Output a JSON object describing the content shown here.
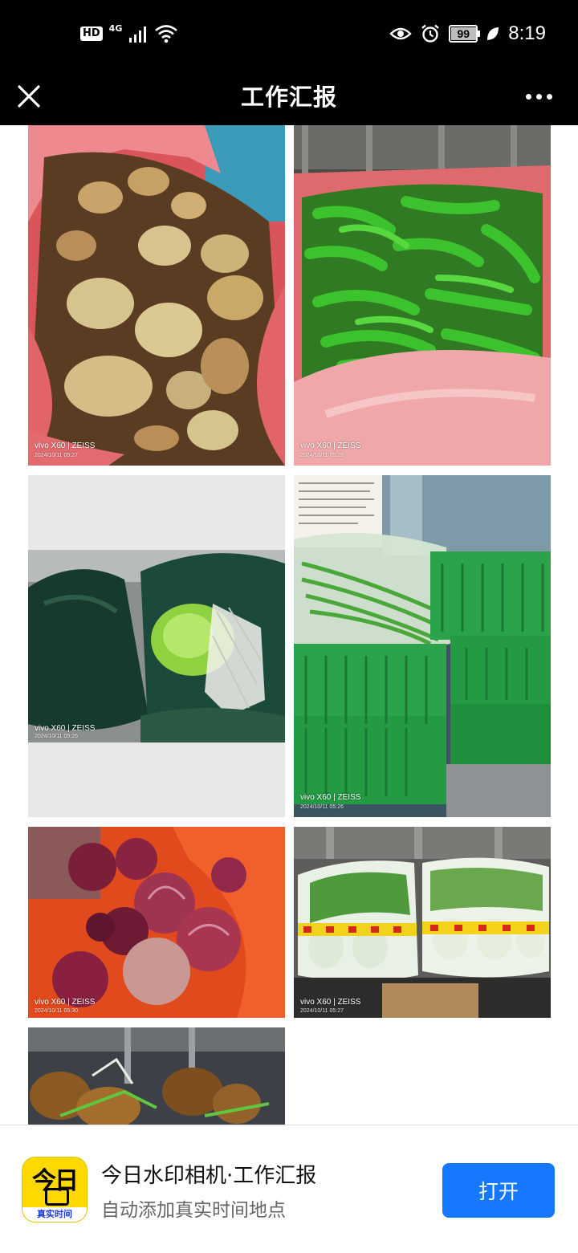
{
  "status_bar": {
    "hd": "HD",
    "network": "4G",
    "battery": "99",
    "time": "8:19"
  },
  "header": {
    "title": "工作汇报",
    "close_icon": "close-icon",
    "more_icon": "more-dots-icon"
  },
  "photos": [
    {
      "subject": "potatoes",
      "watermark_brand": "vivo X60 | ZEISS",
      "watermark_date": "2024/10/11 05:27"
    },
    {
      "subject": "green peppers",
      "watermark_brand": "vivo X60 | ZEISS",
      "watermark_date": "2024/10/11 05:28"
    },
    {
      "subject": "lettuce in bags",
      "watermark_brand": "vivo X60 | ZEISS",
      "watermark_date": "2024/10/11 05:26"
    },
    {
      "subject": "garlic sprouts in green crates",
      "watermark_brand": "vivo X60 | ZEISS",
      "watermark_date": "2024/10/11 05:26"
    },
    {
      "subject": "red onions",
      "watermark_brand": "vivo X60 | ZEISS",
      "watermark_date": "2024/10/11 05:30"
    },
    {
      "subject": "napa cabbage",
      "watermark_brand": "vivo X60 | ZEISS",
      "watermark_date": "2024/10/11 05:27"
    },
    {
      "subject": "ginger",
      "watermark_brand": "",
      "watermark_date": ""
    }
  ],
  "banner": {
    "icon_text": "今日",
    "icon_strip": "真实时间",
    "app_name": "今日水印相机·工作汇报",
    "app_desc": "自动添加真实时间地点",
    "open_label": "打开"
  }
}
